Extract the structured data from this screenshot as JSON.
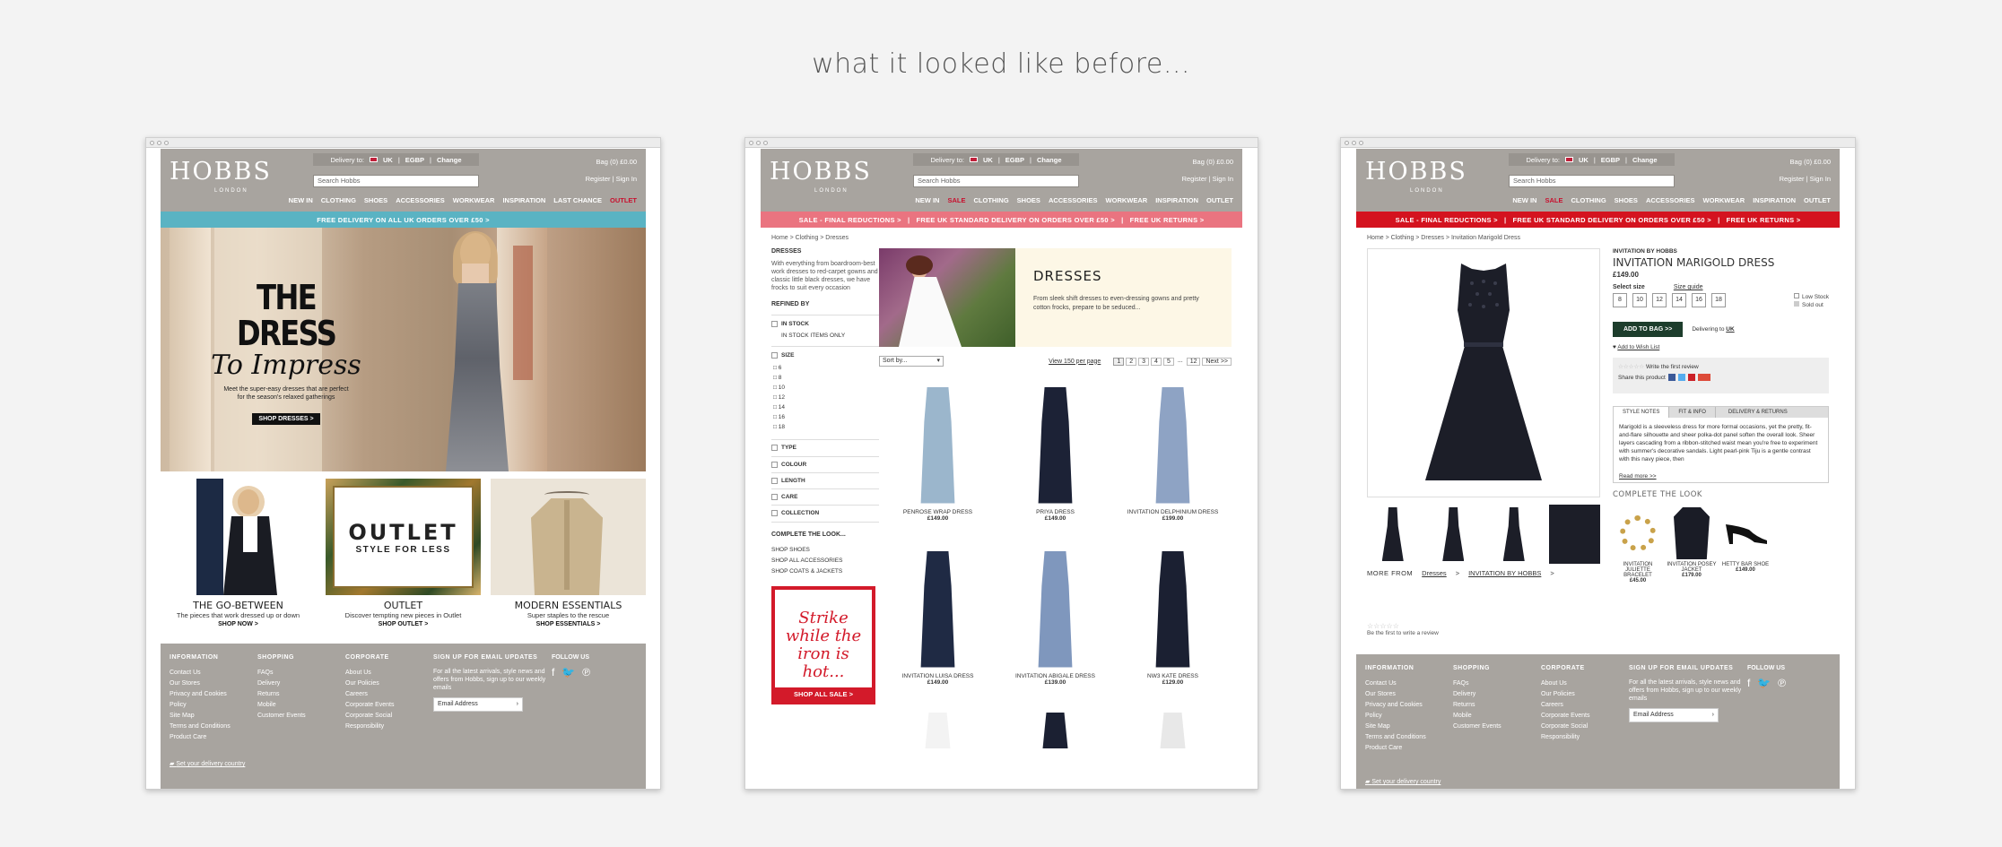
{
  "headline": "what it looked like before...",
  "site": {
    "logo": "HOBBS",
    "logo_sub": "LONDON",
    "delivery_label": "Delivery to:",
    "delivery_country": "UK",
    "currency": "EGBP",
    "change": "Change",
    "bag": "Bag (0) £0.00",
    "search_placeholder": "Search Hobbs",
    "register": "Register | Sign In",
    "nav_home": [
      "NEW IN",
      "CLOTHING",
      "SHOES",
      "ACCESSORIES",
      "WORKWEAR",
      "INSPIRATION",
      "LAST CHANCE",
      "OUTLET"
    ],
    "nav_sale": [
      "NEW IN",
      "SALE",
      "CLOTHING",
      "SHOES",
      "ACCESSORIES",
      "WORKWEAR",
      "INSPIRATION",
      "OUTLET"
    ]
  },
  "home": {
    "promo": "FREE DELIVERY ON ALL UK ORDERS OVER £50 >",
    "hero_title1": "THE DRESS",
    "hero_title2": "To Impress",
    "hero_text": "Meet the super-easy dresses that are perfect for the season's relaxed gatherings",
    "hero_cta": "SHOP DRESSES >",
    "tiles": [
      {
        "title": "THE GO-BETWEEN",
        "sub": "The pieces that work dressed up or down",
        "cta": "SHOP NOW >"
      },
      {
        "title": "OUTLET",
        "sub": "Discover tempting new pieces in Outlet",
        "cta": "SHOP OUTLET >",
        "box1": "OUTLET",
        "box2": "STYLE FOR LESS"
      },
      {
        "title": "MODERN ESSENTIALS",
        "sub": "Super staples to the rescue",
        "cta": "SHOP ESSENTIALS >"
      }
    ]
  },
  "footer": {
    "info_title": "INFORMATION",
    "info": [
      "Contact Us",
      "Our Stores",
      "Privacy and Cookies",
      "Policy",
      "Site Map",
      "Terms and Conditions",
      "Product Care"
    ],
    "shop_title": "SHOPPING",
    "shop": [
      "FAQs",
      "Delivery",
      "Returns",
      "Mobile",
      "Customer Events"
    ],
    "corp_title": "CORPORATE",
    "corp": [
      "About Us",
      "Our Policies",
      "Careers",
      "Corporate Events",
      "Corporate Social",
      "Responsibility"
    ],
    "sign_title": "SIGN UP FOR EMAIL UPDATES",
    "sign_text": "For all the latest arrivals, style news and offers from Hobbs, sign up to our weekly emails",
    "email_placeholder": "Email Address",
    "follow_title": "FOLLOW US",
    "set_country": "Set your delivery country"
  },
  "listing": {
    "promo": "SALE - FINAL REDUCTIONS >   |   FREE UK STANDARD DELIVERY ON ORDERS OVER £50 >   |   FREE UK RETURNS >",
    "breadcrumb": "Home  >  Clothing  >  Dresses",
    "side_title": "DRESSES",
    "side_text": "With everything from boardroom-best work dresses to red-carpet gowns and classic little black dresses, we have frocks to suit every occasion",
    "refined": "REFINED BY",
    "in_stock": "IN STOCK",
    "in_stock_only": "IN STOCK ITEMS ONLY",
    "size": "SIZE",
    "sizes": [
      "6",
      "8",
      "10",
      "12",
      "14",
      "16",
      "18"
    ],
    "filters": [
      "TYPE",
      "COLOUR",
      "LENGTH",
      "CARE",
      "COLLECTION"
    ],
    "complete": "COMPLETE THE LOOK...",
    "links": [
      "SHOP SHOES",
      "SHOP ALL ACCESSORIES",
      "SHOP COATS & JACKETS"
    ],
    "strike1": "Strike",
    "strike2": "while the",
    "strike3": "iron is hot...",
    "strike_cta": "SHOP ALL SALE >",
    "banner_title": "DRESSES",
    "banner_text": "From sleek shift dresses to even-dressing gowns and pretty cotton frocks, prepare to be seduced...",
    "sort": "Sort by...",
    "per_page": "View 150 per page",
    "pages": [
      "1",
      "2",
      "3",
      "4",
      "5",
      "...",
      "12",
      "Next >>"
    ],
    "products": [
      {
        "name": "PENROSE WRAP DRESS",
        "price": "£149.00",
        "color": "#9bb6cc"
      },
      {
        "name": "PRIYA DRESS",
        "price": "£149.00",
        "color": "#1c2236"
      },
      {
        "name": "INVITATION DELPHINIUM DRESS",
        "price": "£199.00",
        "color": "#8ea3c4"
      },
      {
        "name": "INVITATION LUISA DRESS",
        "price": "£149.00",
        "color": "#1f2a44"
      },
      {
        "name": "INVITATION ABIGALE DRESS",
        "price": "£139.00",
        "color": "#7f97bd"
      },
      {
        "name": "NW3 KATE DRESS",
        "price": "£129.00",
        "color": "#1b2032"
      }
    ]
  },
  "product": {
    "promo": "SALE - FINAL REDUCTIONS >   |   FREE UK STANDARD DELIVERY ON ORDERS OVER £50 >   |   FREE UK RETURNS >",
    "breadcrumb": "Home  >  Clothing  >  Dresses  >  Invitation Marigold Dress",
    "brand": "INVITATION BY HOBBS",
    "name": "INVITATION MARIGOLD DRESS",
    "price": "£149.00",
    "select_size": "Select size",
    "size_guide": "Size guide",
    "sizes": [
      "8",
      "10",
      "12",
      "14",
      "16",
      "18"
    ],
    "low_stock": "Low Stock",
    "sold_out": "Sold out",
    "add_bag": "ADD TO BAG >>",
    "delivering": "Delivering to",
    "deliv_country": "UK",
    "wish": "Add to Wish List",
    "review": "Write the first review",
    "share": "Share this product",
    "tabs": [
      "STYLE NOTES",
      "FIT & INFO",
      "DELIVERY & RETURNS"
    ],
    "notes": "Marigold is a sleeveless dress for more formal occasions, yet the pretty, fit-and-flare silhouette and sheer polka-dot panel soften the overall look. Sheer layers cascading from a ribbon-stitched waist mean you're free to experiment with summer's decorative sandals. Light pearl-pink Tiju is a gentle contrast with this navy piece, then",
    "read_more": "Read more >>",
    "complete": "COMPLETE THE LOOK",
    "look": [
      {
        "name": "INVITATION JULIETTE BRACELET",
        "price": "£45.00"
      },
      {
        "name": "INVITATION POSEY JACKET",
        "price": "£179.00"
      },
      {
        "name": "HETTY BAR SHOE",
        "price": "£149.00"
      }
    ],
    "more_from": "MORE FROM",
    "more_links": [
      "Dresses",
      "INVITATION BY HOBBS"
    ],
    "first_review": "Be the first to write a review"
  }
}
